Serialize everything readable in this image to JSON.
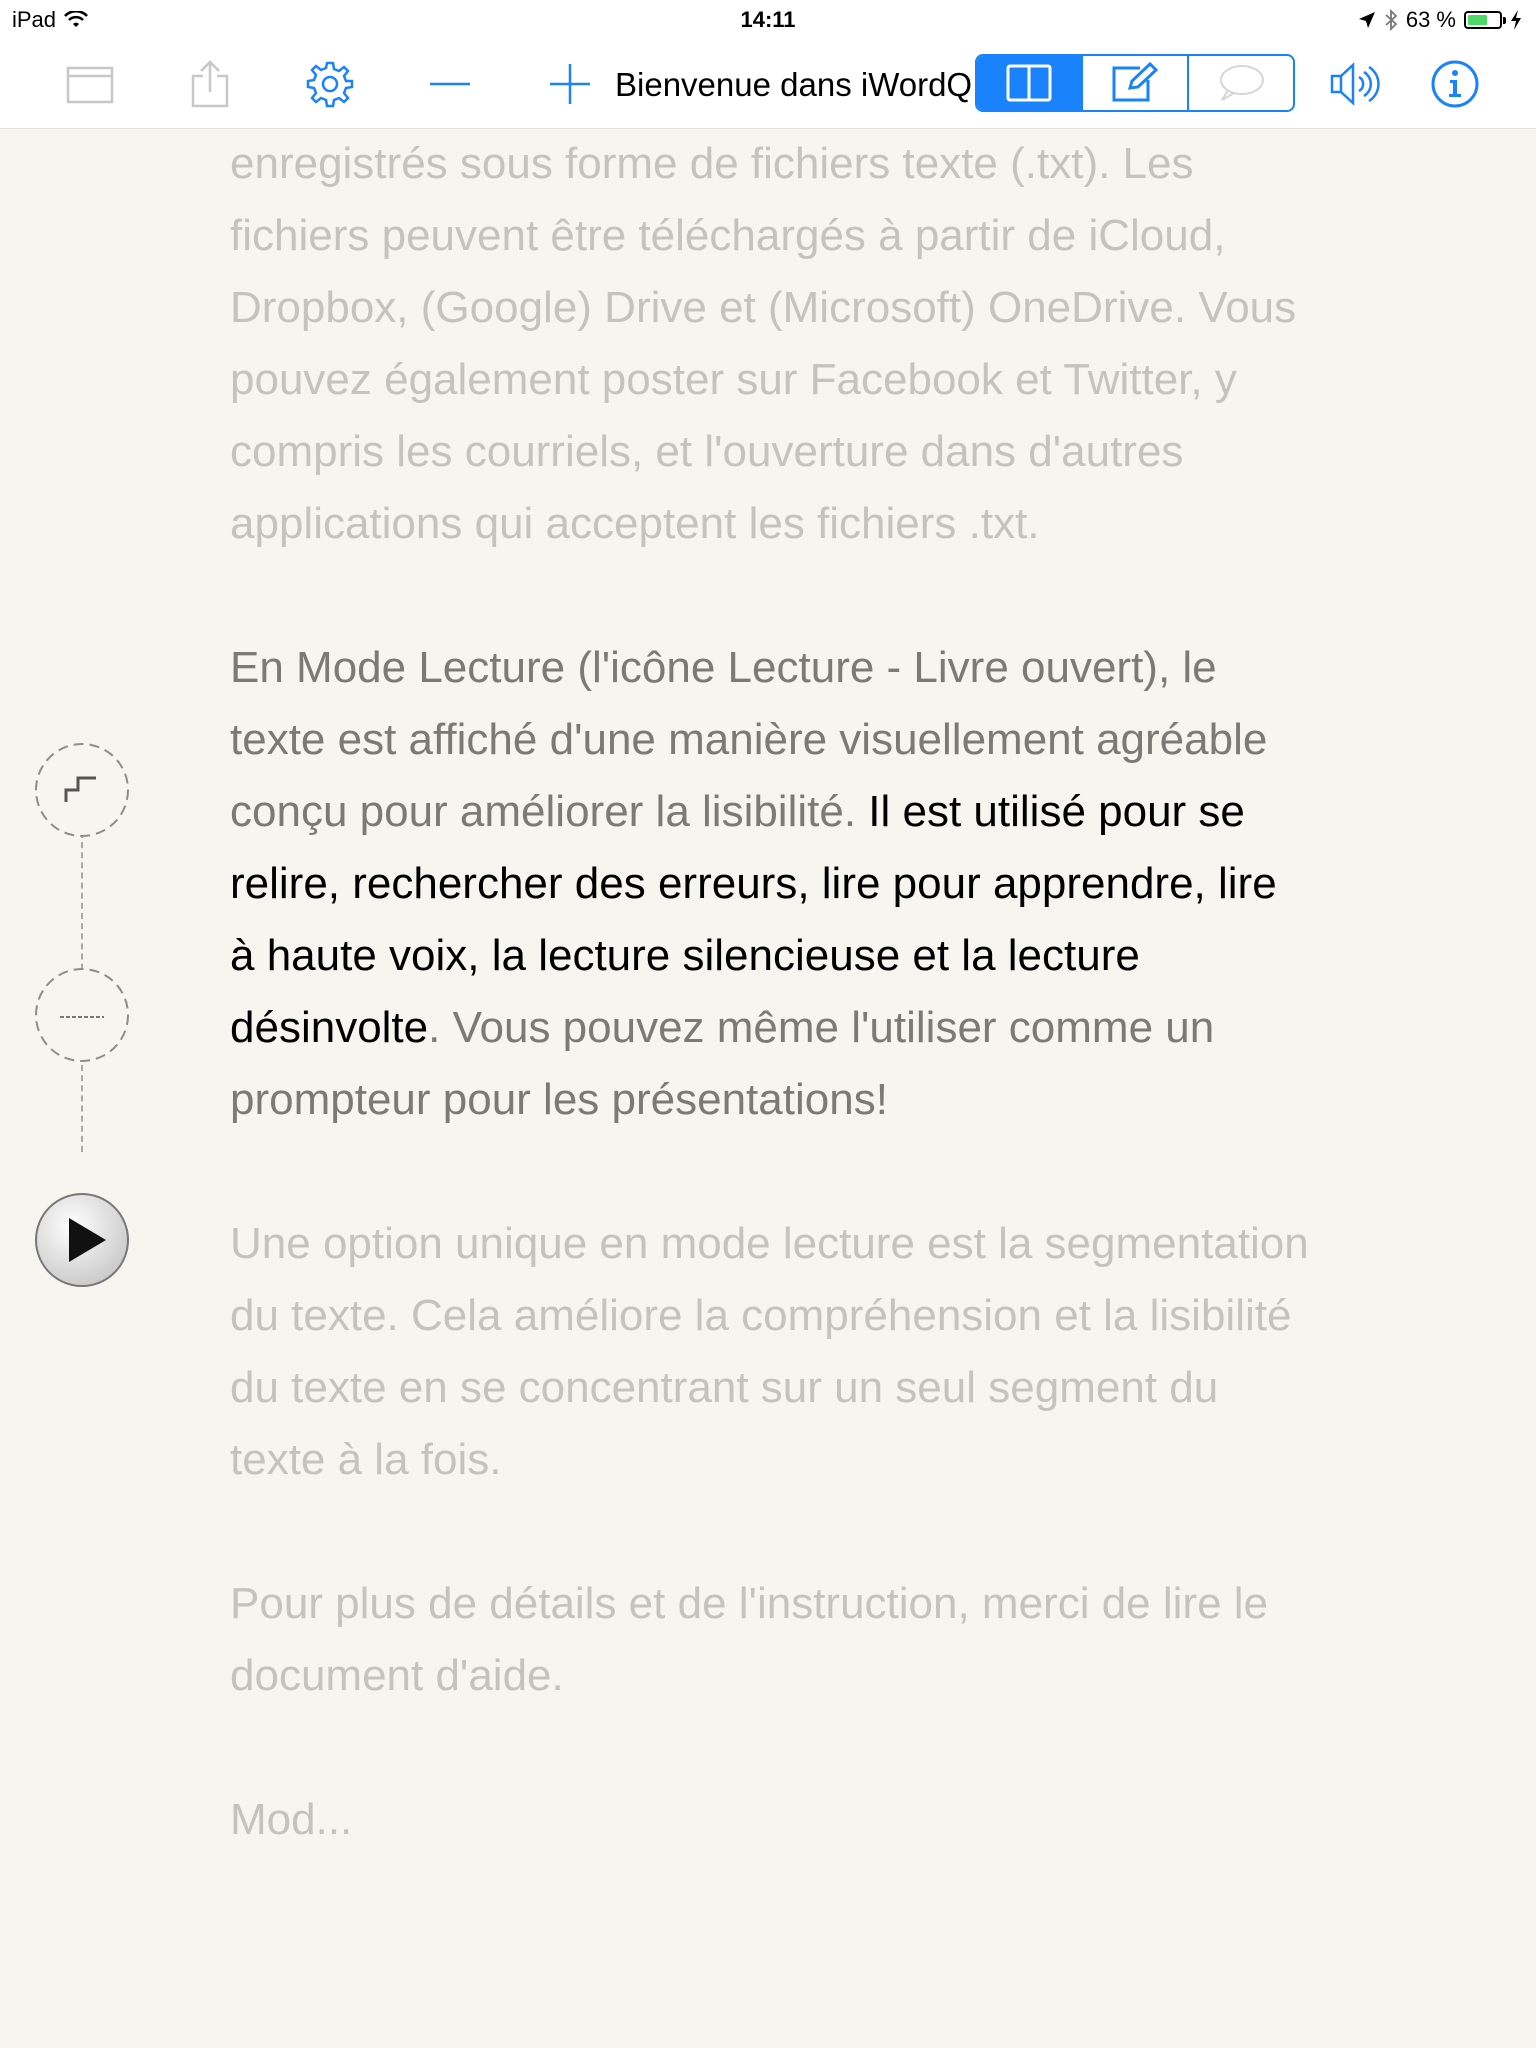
{
  "status_bar": {
    "device": "iPad",
    "time": "14:11",
    "battery": "63 %",
    "battery_level": 0.63
  },
  "toolbar": {
    "title": "Bienvenue dans iWordQ",
    "icons": [
      "folder-icon",
      "share-icon",
      "settings-gear-icon",
      "decrease-font-icon",
      "increase-font-icon",
      "speaker-icon",
      "info-icon"
    ],
    "modes": [
      {
        "name": "read-mode",
        "icon": "open-book-icon",
        "active": true
      },
      {
        "name": "write-mode",
        "icon": "edit-pencil-icon",
        "active": false
      },
      {
        "name": "speech-mode",
        "icon": "speech-bubble-icon",
        "active": false
      }
    ],
    "accent_color": "#1a82fb"
  },
  "document": {
    "p1": "enregistrés sous forme de fichiers texte (.txt). Les fichiers peuvent être téléchargés à partir de iCloud, Dropbox, (Google) Drive et (Microsoft) OneDrive. Vous pouvez également poster sur Facebook et Twitter, y compris les courriels, et l'ouverture dans d'autres applications qui acceptent les fichiers .txt.",
    "p2_before": "En Mode Lecture (l'icône Lecture - Livre ouvert), le texte est affiché d'une manière visuellement agréable conçu pour améliorer la lisibilité. ",
    "p2_highlight": "Il est utilisé pour se relire, rechercher des erreurs, lire pour apprendre, lire à haute voix, la lecture silencieuse et la lecture désinvolte",
    "p2_after": ". Vous pouvez même l'utiliser comme un prompteur pour les présentations!",
    "p3": "Une option unique en mode lecture est la segmentation du texte. Cela améliore la compréhension et la lisibilité du texte en se concentrant sur un seul segment du texte à la fois.",
    "p4": "Pour plus de détails et de l'instruction, merci de lire le document d'aide.",
    "p5": "Mod..."
  },
  "reader_controls": [
    "step-segment-icon",
    "line-segment-icon",
    "play-icon"
  ]
}
